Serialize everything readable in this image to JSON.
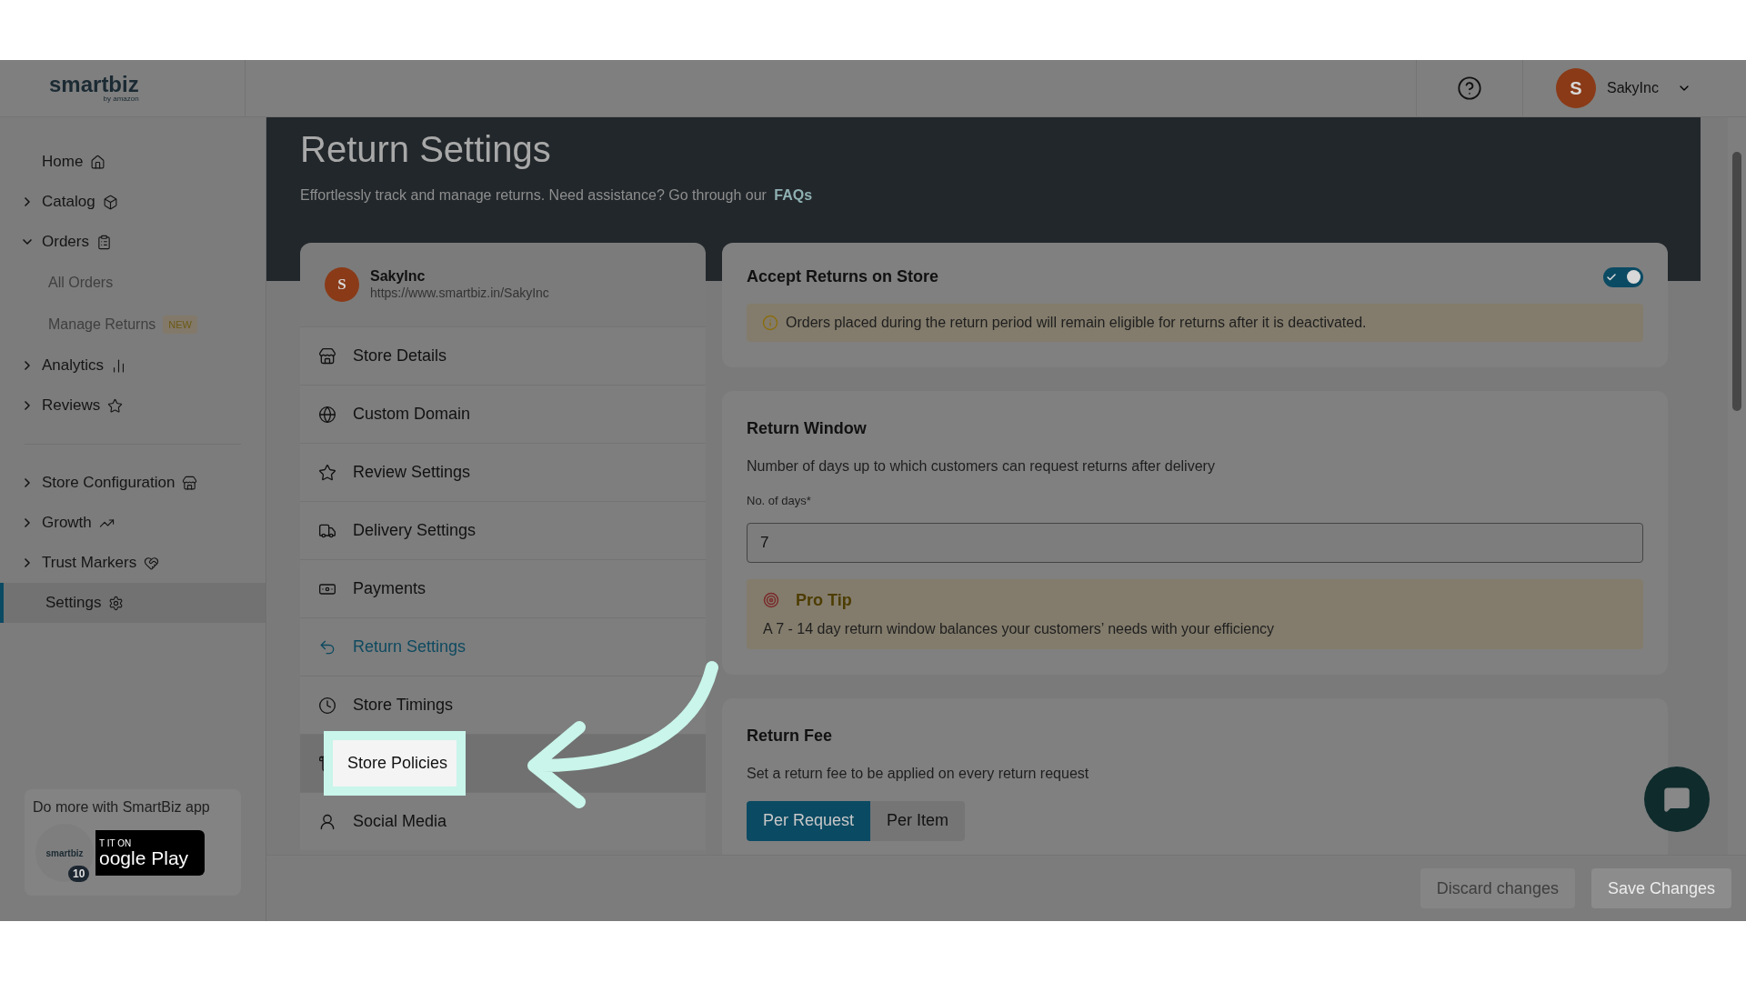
{
  "brand": {
    "logo": "smartbiz",
    "logo_sub": "by amazon"
  },
  "user": {
    "initial": "S",
    "name": "SakyInc"
  },
  "sidebar": {
    "items": [
      {
        "label": "Home",
        "expandable": false,
        "selected": false
      },
      {
        "label": "Catalog",
        "expandable": true,
        "expanded": false,
        "selected": false
      },
      {
        "label": "Orders",
        "expandable": true,
        "expanded": true,
        "selected": false,
        "children": [
          {
            "label": "All Orders"
          },
          {
            "label": "Manage Returns",
            "badge": "NEW"
          }
        ]
      },
      {
        "label": "Analytics",
        "expandable": true,
        "expanded": false,
        "selected": false
      },
      {
        "label": "Reviews",
        "expandable": true,
        "expanded": false,
        "selected": false
      },
      {
        "label": "Store Configuration",
        "expandable": true,
        "expanded": false,
        "selected": false
      },
      {
        "label": "Growth",
        "expandable": true,
        "expanded": false,
        "selected": false
      },
      {
        "label": "Trust Markers",
        "expandable": true,
        "expanded": false,
        "selected": false
      },
      {
        "label": "Settings",
        "expandable": false,
        "selected": true
      }
    ],
    "promo": {
      "text": "Do more with SmartBiz app",
      "badge_line1": "T IT ON",
      "badge_line2": "oogle Play",
      "app_logo": "smartbiz",
      "count": "10"
    }
  },
  "page": {
    "title": "Return Settings",
    "subtitle": "Effortlessly track and manage returns. Need assistance? Go through our",
    "link": "FAQs"
  },
  "store": {
    "initial": "S",
    "name": "SakyInc",
    "url": "https://www.smartbiz.in/SakyInc"
  },
  "settings_menu": [
    {
      "label": "Store Details",
      "selected": false,
      "highlighted": false
    },
    {
      "label": "Custom Domain",
      "selected": false,
      "highlighted": false
    },
    {
      "label": "Review Settings",
      "selected": false,
      "highlighted": false
    },
    {
      "label": "Delivery Settings",
      "selected": false,
      "highlighted": false
    },
    {
      "label": "Payments",
      "selected": false,
      "highlighted": false
    },
    {
      "label": "Return Settings",
      "selected": true,
      "highlighted": false
    },
    {
      "label": "Store Timings",
      "selected": false,
      "highlighted": false
    },
    {
      "label": "Store Policies",
      "selected": false,
      "highlighted": true
    },
    {
      "label": "Social Media",
      "selected": false,
      "highlighted": false
    }
  ],
  "accept_returns": {
    "title": "Accept Returns on Store",
    "on": true,
    "note": "Orders placed during the return period will remain eligible for returns after it is deactivated."
  },
  "return_window": {
    "title": "Return Window",
    "description": "Number of days up to which customers can request returns after delivery",
    "field_label": "No. of days*",
    "value": "7",
    "tip_title": "Pro Tip",
    "tip_text": "A 7 - 14 day return window balances your customers’ needs with your efficiency"
  },
  "return_fee": {
    "title": "Return Fee",
    "description": "Set a return fee to be applied on every return request",
    "options": [
      {
        "label": "Per Request",
        "selected": true
      },
      {
        "label": "Per Item",
        "selected": false
      }
    ]
  },
  "footer": {
    "buttons": [
      {
        "label": "Discard changes",
        "disabled": true
      },
      {
        "label": "Save Changes",
        "disabled": true
      }
    ]
  }
}
